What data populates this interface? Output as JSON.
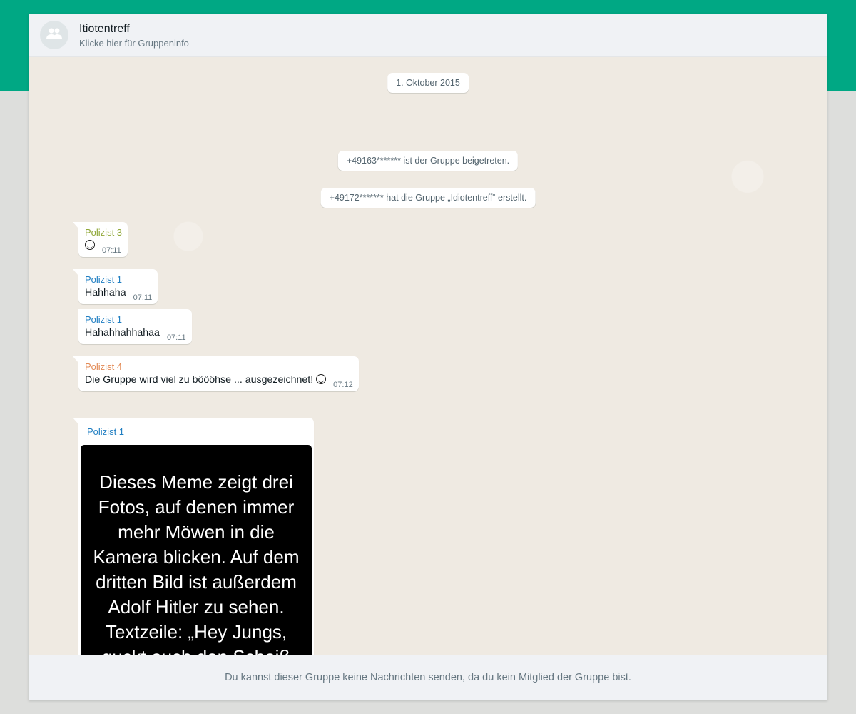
{
  "header": {
    "group_name": "Itiotentreff",
    "subtitle": "Klicke hier für Gruppeninfo",
    "avatar_icon": "group-icon"
  },
  "chat": {
    "date_badge": "1. Oktober 2015",
    "system_messages": [
      "+49163******* ist der Gruppe beigetreten.",
      "+49172******* hat die Gruppe „Idiotentreff“ erstellt."
    ],
    "messages": [
      {
        "sender": "Polizist 3",
        "sender_color": "#8fa736",
        "text": "",
        "emoji": "laughing-face-emoji",
        "time": "07:11"
      },
      {
        "sender": "Polizist 1",
        "sender_color": "#1f7ec2",
        "text": "Hahhaha",
        "time": "07:11"
      },
      {
        "sender": "Polizist 1",
        "sender_color": "#1f7ec2",
        "text": "Hahahhahhahaa",
        "time": "07:11"
      },
      {
        "sender": "Polizist 4",
        "sender_color": "#e38a55",
        "text": "Die Gruppe wird viel zu böööhse ... ausgezeichnet!",
        "emoji": "grinning-face-emoji",
        "time": "07:12"
      }
    ],
    "media_message": {
      "sender": "Polizist 1",
      "sender_color": "#1f7ec2",
      "image_text": "Dieses Meme zeigt drei Fotos, auf denen immer mehr Möwen in die Kamera blicken. Auf dem dritten Bild ist außerdem Adolf Hitler zu sehen. Textzeile: „Hey Jungs, guckt euch den Scheiß"
    }
  },
  "footer": {
    "notice": "Du kannst dieser Gruppe keine Nachrichten senden, da du kein Mitglied der Gruppe bist."
  },
  "colors": {
    "brand_band": "#00a884",
    "chat_background": "#efeae2",
    "header_background": "#f0f2f5"
  }
}
